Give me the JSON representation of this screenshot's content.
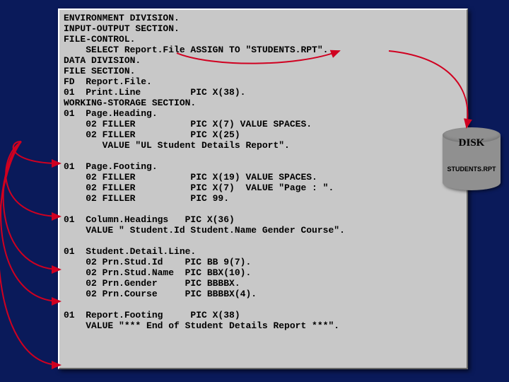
{
  "code": {
    "l1": "ENVIRONMENT DIVISION.",
    "l2": "INPUT-OUTPUT SECTION.",
    "l3": "FILE-CONTROL.",
    "l4": "    SELECT Report.File ASSIGN TO \"STUDENTS.RPT\".",
    "l5": "DATA DIVISION.",
    "l6": "FILE SECTION.",
    "l7": "FD  Report.File.",
    "l8": "01  Print.Line         PIC X(38).",
    "l9": "WORKING-STORAGE SECTION.",
    "l10": "01  Page.Heading.",
    "l11": "    02 FILLER          PIC X(7) VALUE SPACES.",
    "l12": "    02 FILLER          PIC X(25)",
    "l13": "       VALUE \"UL Student Details Report\".",
    "blank1": "",
    "l14": "01  Page.Footing.",
    "l15": "    02 FILLER          PIC X(19) VALUE SPACES.",
    "l16": "    02 FILLER          PIC X(7)  VALUE \"Page : \".",
    "l17": "    02 FILLER          PIC 99.",
    "blank2": "",
    "l18": "01  Column.Headings   PIC X(36)",
    "l19": "    VALUE \" Student.Id Student.Name Gender Course\".",
    "blank3": "",
    "l20": "01  Student.Detail.Line.",
    "l21": "    02 Prn.Stud.Id    PIC BB 9(7).",
    "l22": "    02 Prn.Stud.Name  PIC BBX(10).",
    "l23": "    02 Prn.Gender     PIC BBBBX.",
    "l24": "    02 Prn.Course     PIC BBBBX(4).",
    "blank4": "",
    "l25": "01  Report.Footing     PIC X(38)",
    "l26": "    VALUE \"*** End of Student Details Report ***\"."
  },
  "disk": {
    "label": "DISK",
    "file": "STUDENTS.RPT"
  }
}
